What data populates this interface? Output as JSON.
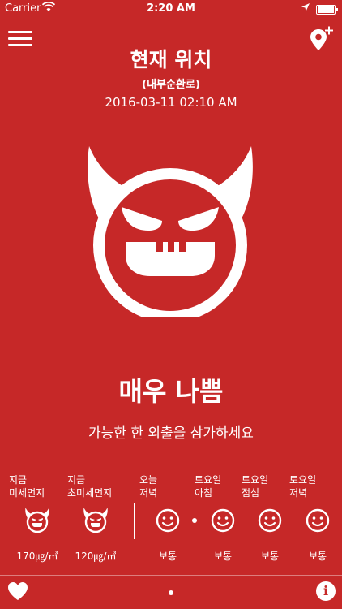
{
  "status_bar": {
    "carrier": "Carrier",
    "time": "2:20 AM"
  },
  "header": {
    "title": "현재 위치",
    "subtitle": "(내부순환로)",
    "datetime": "2016-03-11 02:10 AM"
  },
  "main": {
    "status_label": "매우 나쁨",
    "advice": "가능한 한 외출을 삼가하세요",
    "face_icon": "devil-face-icon"
  },
  "current": [
    {
      "label_line1": "지금",
      "label_line2": "미세먼지",
      "icon": "devil-face-icon",
      "value": "170㎍/㎥"
    },
    {
      "label_line1": "지금",
      "label_line2": "초미세먼지",
      "icon": "devil-face-icon",
      "value": "120㎍/㎥"
    }
  ],
  "forecast": [
    {
      "label_line1": "오늘",
      "label_line2": "저녁",
      "icon": "smile-face-icon",
      "value": "보통"
    },
    {
      "label_line1": "토요일",
      "label_line2": "아침",
      "icon": "smile-face-icon",
      "value": "보통"
    },
    {
      "label_line1": "토요일",
      "label_line2": "점심",
      "icon": "smile-face-icon",
      "value": "보통"
    },
    {
      "label_line1": "토요일",
      "label_line2": "저녁",
      "icon": "smile-face-icon",
      "value": "보통"
    }
  ],
  "footer": {
    "info_label": "i"
  },
  "colors": {
    "background": "#c62828",
    "foreground": "#ffffff"
  }
}
